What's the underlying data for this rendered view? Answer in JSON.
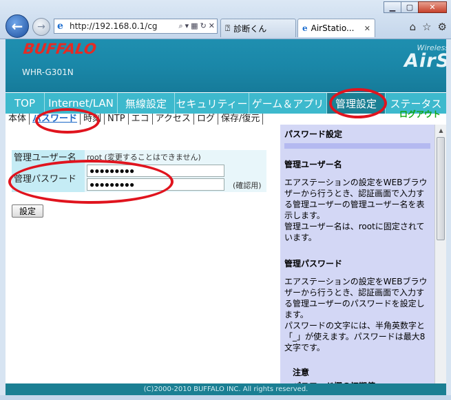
{
  "browser": {
    "url": "http://192.168.0.1/cg",
    "tabs": [
      {
        "label": "診断くん"
      },
      {
        "label": "AirStatio..."
      }
    ]
  },
  "banner": {
    "logo": "BUFFALO",
    "model": "WHR-G301N",
    "brand_line1": "Wireless",
    "brand_line2": "AirS"
  },
  "mainnav": [
    {
      "label": "TOP"
    },
    {
      "label": "Internet/LAN"
    },
    {
      "label": "無線設定"
    },
    {
      "label": "セキュリティー"
    },
    {
      "label": "ゲーム＆アプリ"
    },
    {
      "label": "管理設定"
    },
    {
      "label": "ステータス"
    }
  ],
  "logout": "ログアウト",
  "subnav": [
    {
      "label": "本体"
    },
    {
      "label": "パスワード"
    },
    {
      "label": "時刻"
    },
    {
      "label": "NTP"
    },
    {
      "label": "エコ"
    },
    {
      "label": "アクセス"
    },
    {
      "label": "ログ"
    },
    {
      "label": "保存/復元"
    }
  ],
  "form": {
    "admin_user_label": "管理ユーザー名",
    "admin_user_value": "root (変更することはできません)",
    "admin_pw_label": "管理パスワード",
    "pw1": "●●●●●●●●●",
    "pw2": "●●●●●●●●●",
    "confirm_label": "(確認用)",
    "submit_label": "設定"
  },
  "help": {
    "title": "パスワード設定",
    "sec1_title": "管理ユーザー名",
    "sec1_p1": "エアステーションの設定をWEBブラウザーから行うとき、認証画面で入力する管理ユーザーの管理ユーザー名を表示します。",
    "sec1_p2": "管理ユーザー名は、rootに固定されています。",
    "sec2_title": "管理パスワード",
    "sec2_p1": "エアステーションの設定をWEBブラウザーから行うとき、認証画面で入力する管理ユーザーのパスワードを設定します。",
    "sec2_p2": "パスワードの文字には、半角英数字と「_」が使えます。パスワードは最大8文字です。",
    "note_title": "注意",
    "note_sub": "パスワード欄の初期値"
  },
  "footer": "(C)2000-2010 BUFFALO INC. All rights reserved.",
  "colors": {
    "banner": "#1a87a8",
    "nav": "#3db9cd",
    "annotation": "#e0141e"
  }
}
